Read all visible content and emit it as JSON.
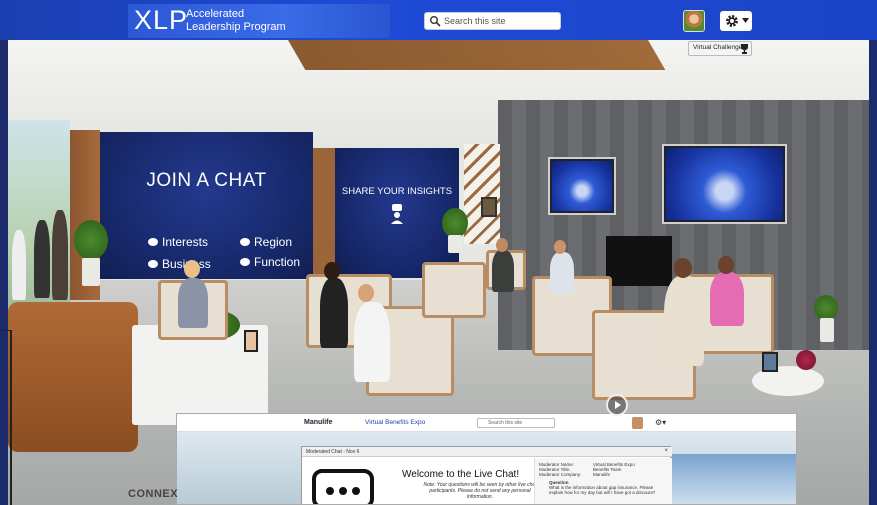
{
  "header": {
    "logo_main": "XLP",
    "logo_line1": "Accelerated",
    "logo_line2": "Leadership Program",
    "search_placeholder": "Search this site",
    "virtual_challenge": "Virtual Challenge",
    "brand_color": "#1e4ad6"
  },
  "room": {
    "join_title": "JOIN A CHAT",
    "join_options": [
      "Interests",
      "Region",
      "Business",
      "Function"
    ],
    "share_title": "SHARE YOUR INSIGHTS"
  },
  "inset": {
    "brand_left": "Manulife",
    "brand_right": "Virtual Benefits Expo",
    "search_placeholder": "Search this site",
    "chat_header": "Moderated Chat - Nov 6",
    "close_label": "×",
    "welcome": "Welcome to the Live Chat!",
    "note": "Note: Your questions will be seen by other live chat participants. Please do not send any personal information.",
    "moderator_name_label": "Moderator Name:",
    "moderator_name": "Virtual Benefits Expo",
    "moderator_title_label": "Moderator Title:",
    "moderator_title": "Benefits Team",
    "moderator_company_label": "Moderator Company:",
    "moderator_company": "Manulife",
    "question_label": "Question",
    "question_text": "What is the information about gap insurance. Please explain how for my day but will I have got a discount?"
  },
  "footer": {
    "connex": "CONNEX"
  },
  "icons": [
    "search-icon",
    "gear-icon",
    "chevron-down-icon",
    "trophy-icon",
    "chat-bubble-icon",
    "share-insights-icon",
    "play-icon"
  ]
}
